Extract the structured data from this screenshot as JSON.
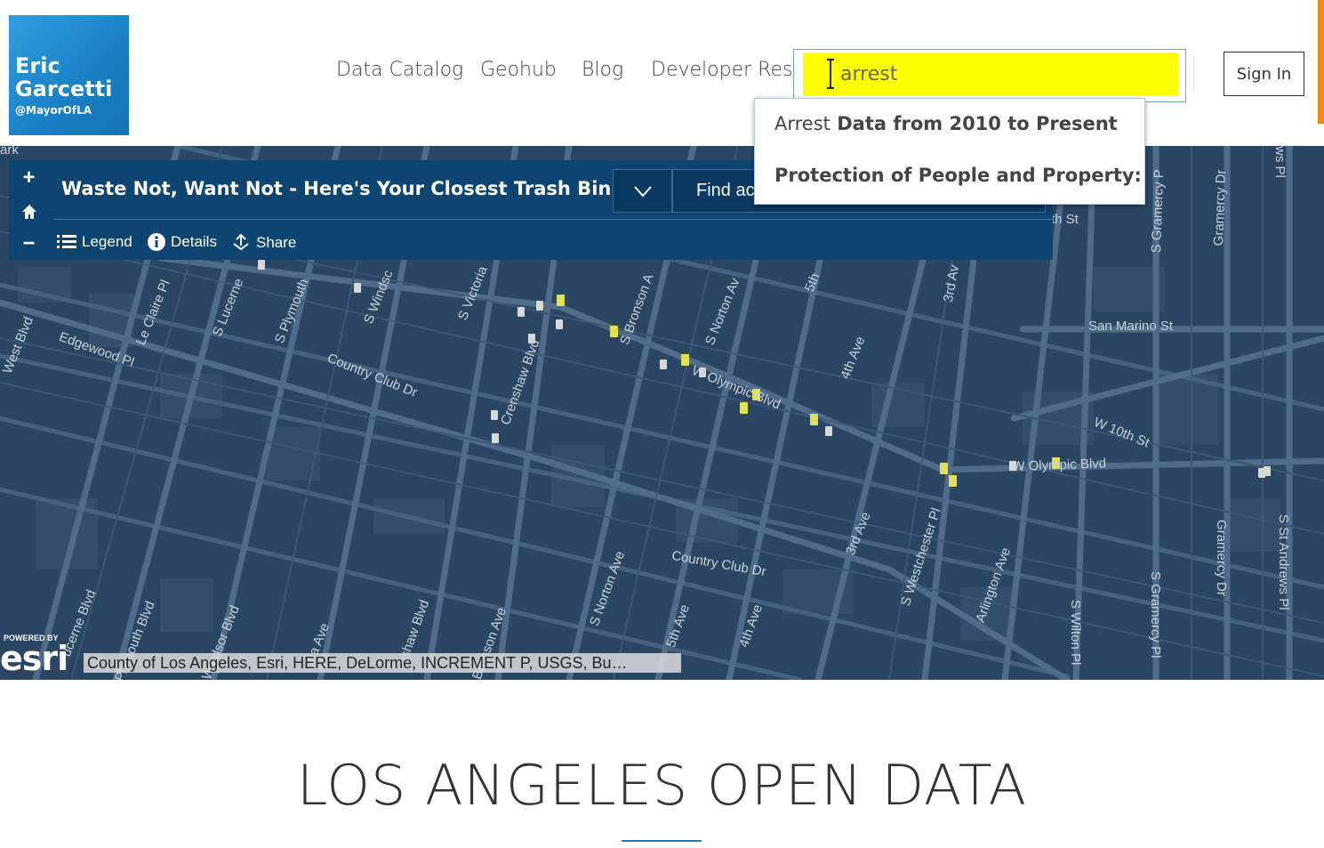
{
  "logo": {
    "line1": "Eric",
    "line2": "Garcetti",
    "handle": "@MayorOfLA"
  },
  "nav": {
    "items": [
      "Data Catalog",
      "Geohub",
      "Blog",
      "Developer Reso"
    ]
  },
  "search": {
    "value": "arrest"
  },
  "signin": {
    "label": "Sign In"
  },
  "autocomplete": {
    "item1": {
      "prefix": "Arrest",
      "rest": " Data from 2010 to Present"
    },
    "item2": {
      "bold": "Protection of People and Property: Crii"
    }
  },
  "map": {
    "app_title": "Waste Not, Want Not - Here's Your Closest Trash Bin!",
    "find_text": "Find ac",
    "tools": {
      "legend": "Legend",
      "details": "Details",
      "share": "Share"
    },
    "zoom_in": "+",
    "zoom_out": "−",
    "esri_powered": "POWERED BY",
    "esri_name": "esri",
    "attribution": "County of Los Angeles, Esri, HERE, DeLorme, INCREMENT P, USGS, Bu…",
    "labels": {
      "edgewood": "Edgewood Pl",
      "leclaire": "Le Claire Pl",
      "country1": "Country Club Dr",
      "country2": "Country Club Dr",
      "olympic1": "W Olympic Blvd",
      "olympic2": "W Olympic Blvd",
      "sanmarino": "San Marino St",
      "tenth": "W 10th St",
      "westblvd": "West Blvd",
      "lucerne": "S Lucerne",
      "plymouth": "S Plymouth",
      "windsor": "S Windsc",
      "victoria": "S Victoria",
      "crenshaw": "Crenshaw Blvd",
      "bronson": "S Bronson A",
      "norton": "S Norton Av",
      "fifth": "5th",
      "fourthave": "4th Ave",
      "thirdave": "3rd Av",
      "thirdave2": "3rd Ave",
      "westchester": "S Westchester Pl",
      "arlington": "Arlington Ave",
      "wilton": "S Wilton Pl",
      "gramercypl": "S Gramercy Pl",
      "gramercydr": "Gramercy Dr",
      "standrews": "S St Andrews Pl",
      "gramercy2": "S Gramercy P",
      "gramercydr2": "Gramercy Dr",
      "ws": "ws Pl",
      "ark": "ark",
      "nortonave2": "S Norton Ave",
      "fifthave2": "5th Ave",
      "fourthave2": "4th Ave",
      "bronsonave2": "Bronson Ave",
      "thst": "th St",
      "lucerne2": "ucerne Blvd",
      "plymouth2": "Plymouth Blvd",
      "windsor2": "Windsor Blvd",
      "victoria2": "oria Ave",
      "crenshaw2": "nshaw Blvd"
    }
  },
  "hero": {
    "title": "LOS ANGELES OPEN DATA"
  }
}
